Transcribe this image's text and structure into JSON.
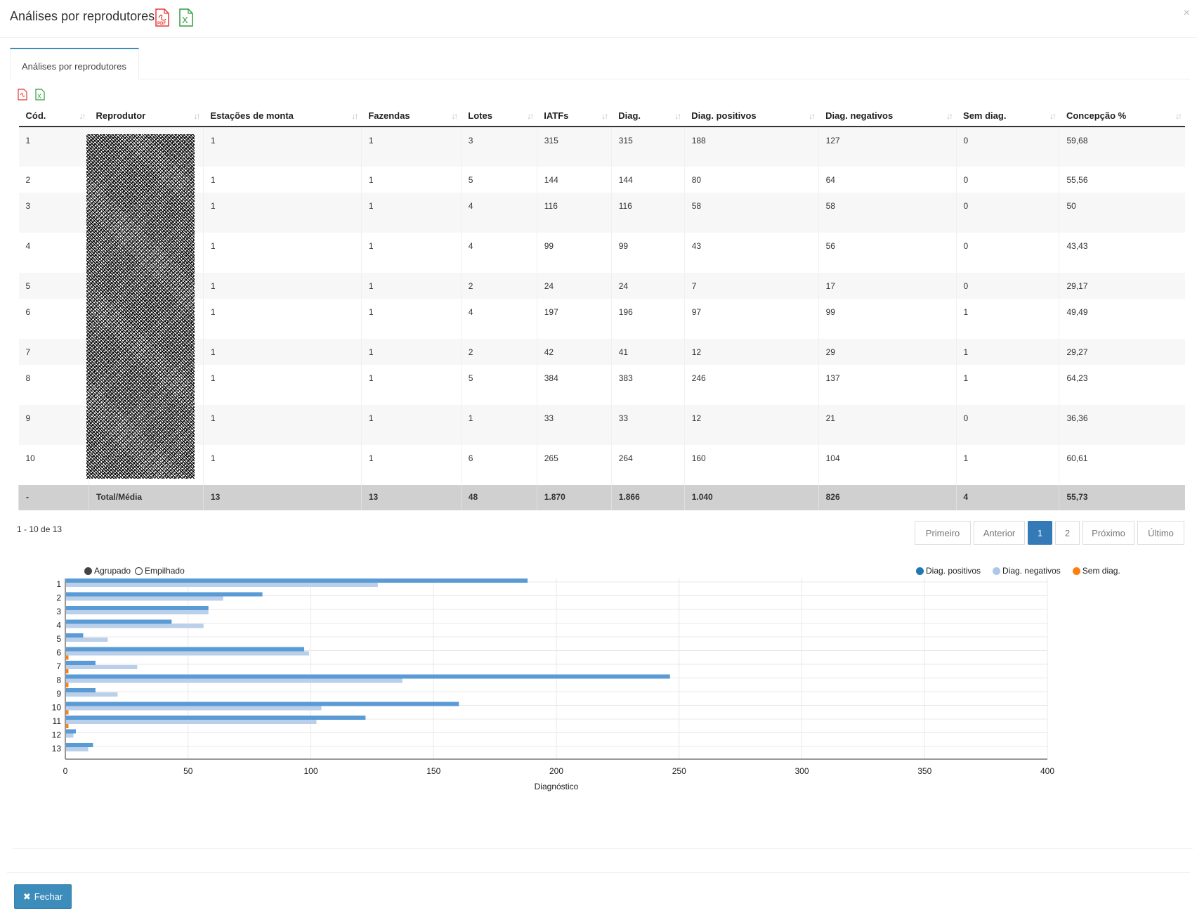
{
  "modal": {
    "title": "Análises por reprodutores",
    "close_glyph": "×"
  },
  "tabs": [
    {
      "label": "Análises por reprodutores"
    }
  ],
  "table": {
    "columns": [
      "Cód.",
      "Reprodutor",
      "Estações de monta",
      "Fazendas",
      "Lotes",
      "IATFs",
      "Diag.",
      "Diag. positivos",
      "Diag. negativos",
      "Sem diag.",
      "Concepção %"
    ],
    "rows": [
      [
        "1",
        "1",
        "1",
        "3",
        "315",
        "315",
        "188",
        "127",
        "0",
        "59,68"
      ],
      [
        "2",
        "1",
        "1",
        "5",
        "144",
        "144",
        "80",
        "64",
        "0",
        "55,56"
      ],
      [
        "3",
        "1",
        "1",
        "4",
        "116",
        "116",
        "58",
        "58",
        "0",
        "50"
      ],
      [
        "4",
        "1",
        "1",
        "4",
        "99",
        "99",
        "43",
        "56",
        "0",
        "43,43"
      ],
      [
        "5",
        "1",
        "1",
        "2",
        "24",
        "24",
        "7",
        "17",
        "0",
        "29,17"
      ],
      [
        "6",
        "1",
        "1",
        "4",
        "197",
        "196",
        "97",
        "99",
        "1",
        "49,49"
      ],
      [
        "7",
        "1",
        "1",
        "2",
        "42",
        "41",
        "12",
        "29",
        "1",
        "29,27"
      ],
      [
        "8",
        "1",
        "1",
        "5",
        "384",
        "383",
        "246",
        "137",
        "1",
        "64,23"
      ],
      [
        "9",
        "1",
        "1",
        "1",
        "33",
        "33",
        "12",
        "21",
        "0",
        "36,36"
      ],
      [
        "10",
        "1",
        "1",
        "6",
        "265",
        "264",
        "160",
        "104",
        "1",
        "60,61"
      ]
    ],
    "total": [
      "-",
      "Total/Média",
      "13",
      "13",
      "48",
      "1.870",
      "1.866",
      "1.040",
      "826",
      "4",
      "55,73"
    ]
  },
  "pagination": {
    "summary": "1 - 10 de 13",
    "first": "Primeiro",
    "prev": "Anterior",
    "pages": [
      "1",
      "2"
    ],
    "current": "1",
    "next": "Próximo",
    "last": "Último"
  },
  "chart_mode": {
    "grouped": "Agrupado",
    "stacked": "Empilhado",
    "selected": "Agrupado"
  },
  "chart_data": {
    "type": "bar",
    "orientation": "horizontal",
    "categories": [
      "1",
      "2",
      "3",
      "4",
      "5",
      "6",
      "7",
      "8",
      "9",
      "10",
      "11",
      "12",
      "13"
    ],
    "series": [
      {
        "name": "Diag. positivos",
        "color": "#5b9bd5",
        "legend_color": "#1f77b4",
        "values": [
          188,
          80,
          58,
          43,
          7,
          97,
          12,
          246,
          12,
          160,
          122,
          4,
          11
        ]
      },
      {
        "name": "Diag. negativos",
        "color": "#b9cfea",
        "legend_color": "#aec7e8",
        "values": [
          127,
          64,
          58,
          56,
          17,
          99,
          29,
          137,
          21,
          104,
          102,
          3,
          9
        ]
      },
      {
        "name": "Sem diag.",
        "color": "#ff7f0e",
        "legend_color": "#ff7f0e",
        "values": [
          0,
          0,
          0,
          0,
          0,
          1,
          1,
          1,
          0,
          1,
          1,
          0,
          0
        ]
      }
    ],
    "xlabel": "Diagnóstico",
    "xlim": [
      0,
      400
    ],
    "xticks": [
      0,
      50,
      100,
      150,
      200,
      250,
      300,
      350,
      400
    ],
    "grid": true,
    "legend_position": "top-right"
  },
  "footer": {
    "close_label": "Fechar"
  }
}
